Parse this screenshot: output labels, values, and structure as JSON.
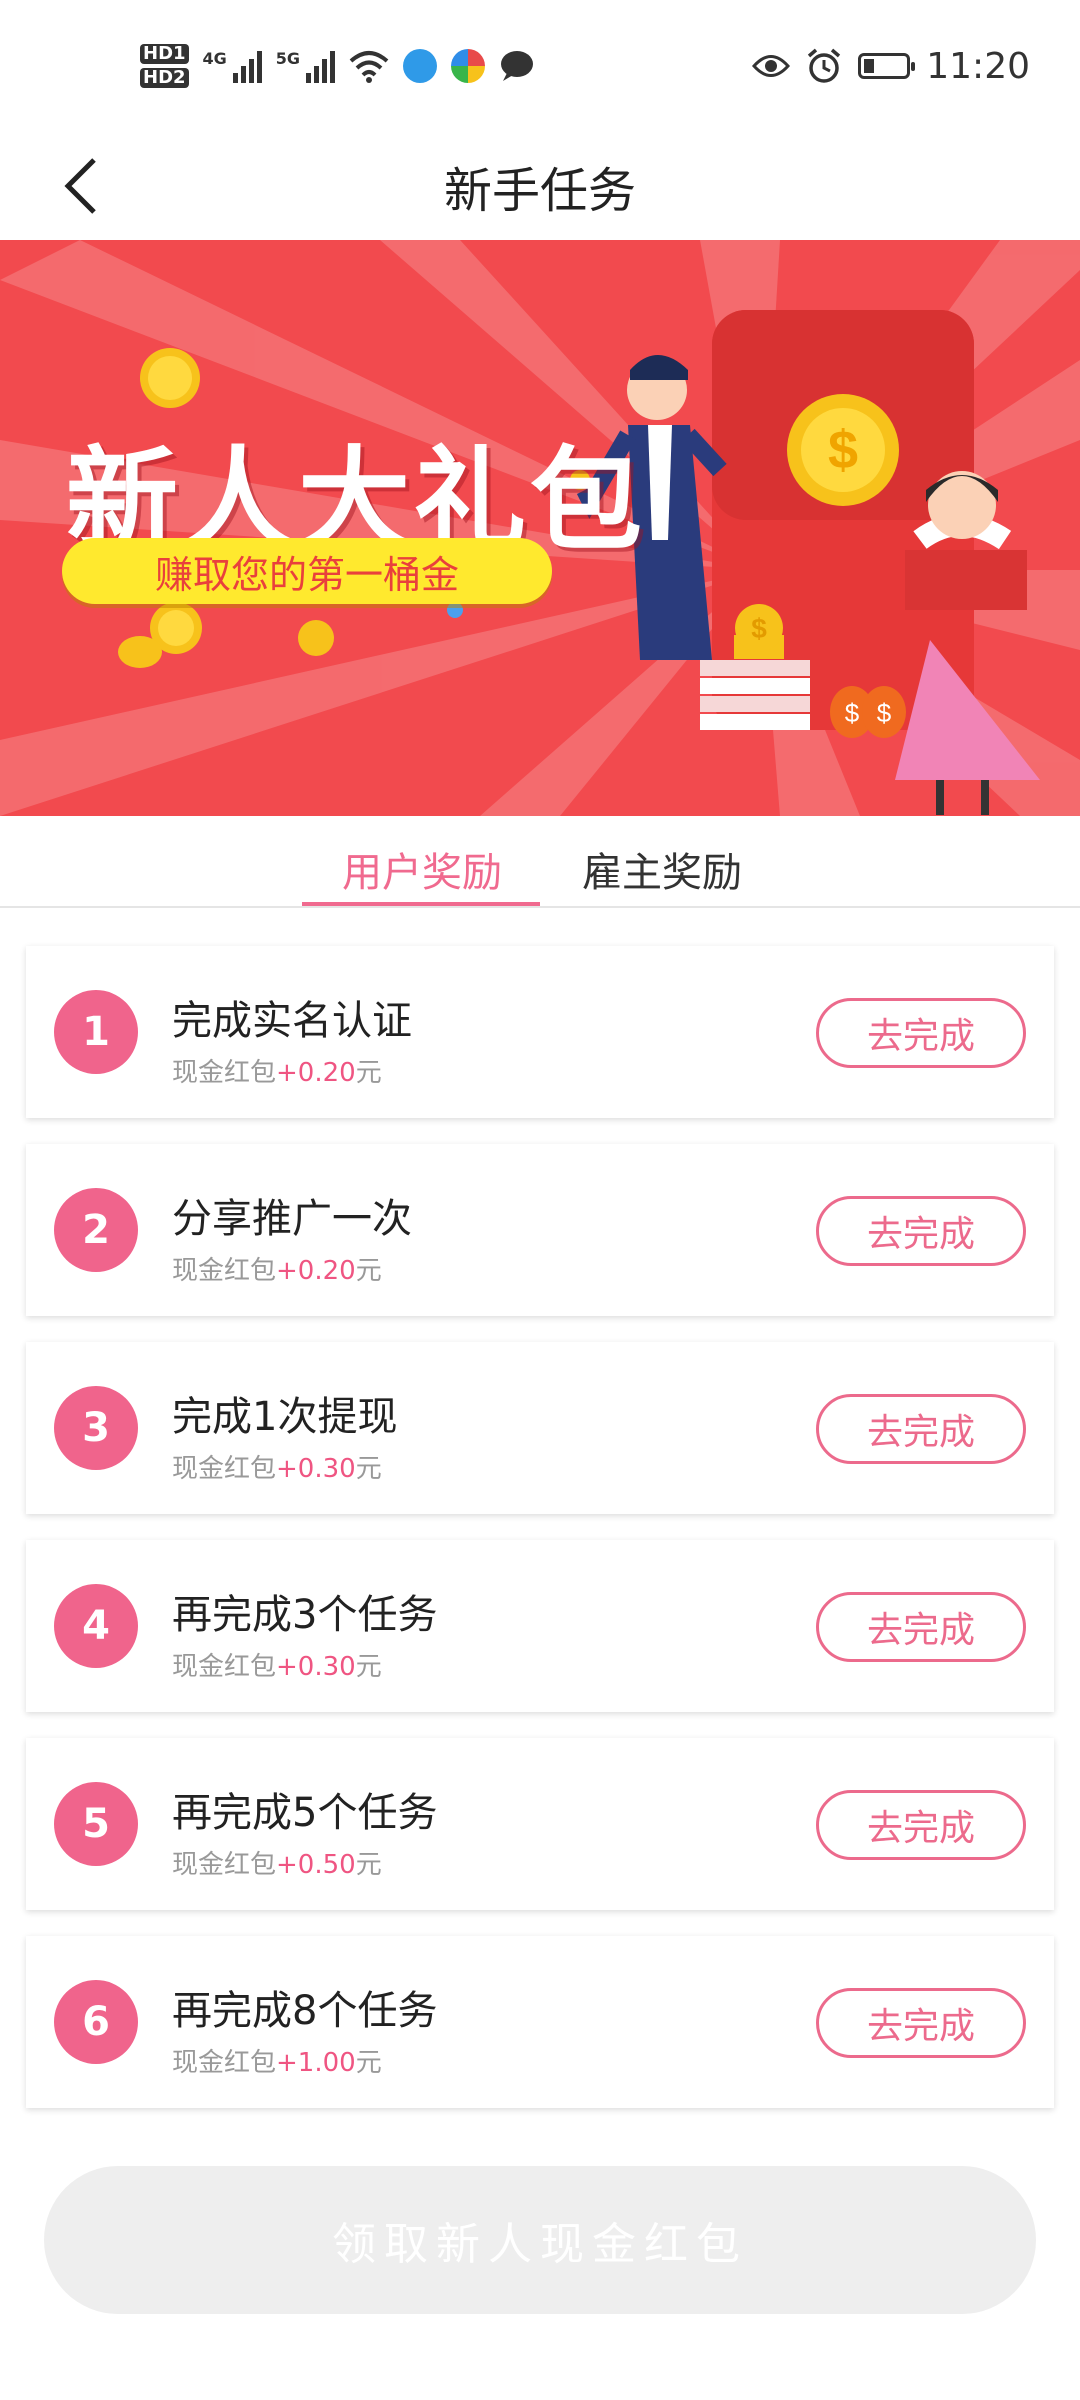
{
  "status_bar": {
    "time": "11:20",
    "sim1": "HD1",
    "sim2": "HD2",
    "net1": "4G",
    "net2": "5G"
  },
  "nav": {
    "title": "新手任务",
    "back_icon": "chevron-left-icon"
  },
  "banner": {
    "title": "新人大礼包",
    "subtitle": "赚取您的第一桶金"
  },
  "tabs": [
    {
      "label": "用户奖励",
      "active": true
    },
    {
      "label": "雇主奖励",
      "active": false
    }
  ],
  "tasks": [
    {
      "number": "1",
      "title": "完成实名认证",
      "reward_prefix": "现金红包",
      "reward_amount": "+0.20",
      "reward_unit": "元",
      "button": "去完成"
    },
    {
      "number": "2",
      "title": "分享推广一次",
      "reward_prefix": "现金红包",
      "reward_amount": "+0.20",
      "reward_unit": "元",
      "button": "去完成"
    },
    {
      "number": "3",
      "title": "完成1次提现",
      "reward_prefix": "现金红包",
      "reward_amount": "+0.30",
      "reward_unit": "元",
      "button": "去完成"
    },
    {
      "number": "4",
      "title": "再完成3个任务",
      "reward_prefix": "现金红包",
      "reward_amount": "+0.30",
      "reward_unit": "元",
      "button": "去完成"
    },
    {
      "number": "5",
      "title": "再完成5个任务",
      "reward_prefix": "现金红包",
      "reward_amount": "+0.50",
      "reward_unit": "元",
      "button": "去完成"
    },
    {
      "number": "6",
      "title": "再完成8个任务",
      "reward_prefix": "现金红包",
      "reward_amount": "+1.00",
      "reward_unit": "元",
      "button": "去完成"
    }
  ],
  "claim_button": "领取新人现金红包",
  "colors": {
    "accent": "#f0648c",
    "banner_bg": "#f24a4e",
    "pill_yellow": "#ffe92e",
    "disabled_btn": "#eeeeee"
  }
}
